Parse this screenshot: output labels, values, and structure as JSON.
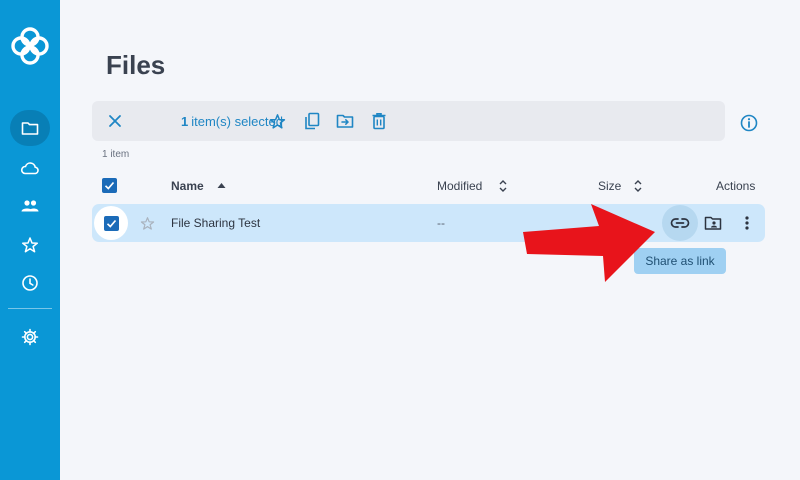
{
  "page": {
    "title": "Files"
  },
  "sidebar": {
    "items": [
      {
        "name": "files",
        "icon": "folder-icon",
        "active": true
      },
      {
        "name": "cloud",
        "icon": "cloud-icon",
        "active": false
      },
      {
        "name": "shared",
        "icon": "people-icon",
        "active": false
      },
      {
        "name": "favorites",
        "icon": "star-icon",
        "active": false
      },
      {
        "name": "recent",
        "icon": "clock-icon",
        "active": false
      },
      {
        "name": "settings",
        "icon": "gear-icon",
        "active": false
      }
    ]
  },
  "selection_bar": {
    "count": "1",
    "label": "item(s) selected",
    "actions": [
      "close-icon",
      "star-icon",
      "copy-icon",
      "move-icon",
      "trash-icon"
    ]
  },
  "list": {
    "item_count": "1 item",
    "headers": {
      "name": "Name",
      "modified": "Modified",
      "size": "Size",
      "actions": "Actions"
    },
    "rows": [
      {
        "name": "File Sharing Test",
        "modified": "--",
        "selected": true,
        "favorite": false
      }
    ]
  },
  "tooltip": {
    "text": "Share as link"
  },
  "colors": {
    "sidebar": "#0a97d6",
    "accent": "#1f86c4",
    "row_selected": "#cde7fb",
    "tooltip": "#9fd0f2",
    "arrow": "#e8141b"
  }
}
